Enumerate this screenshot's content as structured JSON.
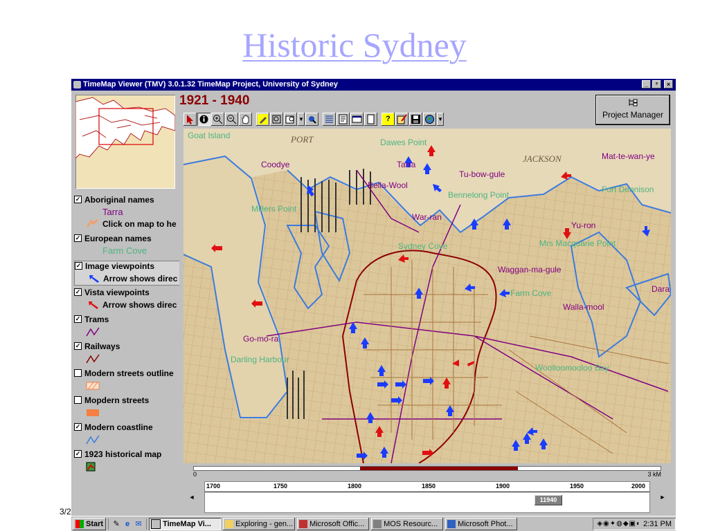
{
  "slide": {
    "title": "Historic Sydney",
    "date": "3/2"
  },
  "window": {
    "title": "TimeMap Viewer (TMV) 3.0.1.32 TimeMap Project, University of Sydney",
    "controls": [
      "_",
      "²",
      "×"
    ]
  },
  "period": "1921 - 1940",
  "project_manager": {
    "label": "Project Manager"
  },
  "toolbar": {
    "buttons": [
      "select-arrow",
      "info",
      "zoom-in",
      "zoom-out",
      "pan-hand",
      "pencil",
      "zoom-box",
      "zoom-layer",
      "dropdown",
      "locate",
      "list",
      "properties",
      "window",
      "page",
      "help",
      "edit-note",
      "save",
      "globe",
      "dropdown"
    ]
  },
  "legend": {
    "groups": [
      {
        "label": "Aboriginal names",
        "checked": true,
        "items": [
          {
            "text": "Tarra",
            "color": "#800080",
            "sym": "text"
          },
          {
            "text": "Click on map to he",
            "sym": "hand"
          }
        ]
      },
      {
        "label": "European names",
        "checked": true,
        "items": [
          {
            "text": "Farm Cove",
            "color": "#4db380",
            "sym": "text"
          }
        ]
      },
      {
        "label": "Image viewpoints",
        "checked": true,
        "items": [
          {
            "text": "Arrow shows direc",
            "sym": "arrow-blue"
          }
        ]
      },
      {
        "label": "Vista viewpoints",
        "checked": true,
        "items": [
          {
            "text": "Arrow shows direc",
            "sym": "arrow-red"
          }
        ]
      },
      {
        "label": "Trams",
        "checked": true,
        "items": [
          {
            "sym": "tram-line"
          }
        ]
      },
      {
        "label": "Railways",
        "checked": true,
        "items": [
          {
            "sym": "rail-line"
          }
        ]
      },
      {
        "label": "Modern streets outline",
        "checked": false,
        "items": [
          {
            "sym": "orange-hatch"
          }
        ]
      },
      {
        "label": "Mopdern streets",
        "checked": false,
        "items": [
          {
            "sym": "orange-fill"
          }
        ]
      },
      {
        "label": "Modern coastline",
        "checked": true,
        "items": [
          {
            "sym": "coast-line"
          }
        ]
      },
      {
        "label": "1923 historical map",
        "checked": true,
        "items": [
          {
            "sym": "map-swatch"
          }
        ]
      }
    ]
  },
  "map_labels": {
    "aboriginal": [
      "Coodye",
      "Tarra",
      "Tu-bow-gule",
      "Bella-Wool",
      "War-ran",
      "Mat-te-wan-ye",
      "Yu-ron",
      "Waggan-ma-gule",
      "Walla-mool",
      "Go-mo-ra",
      "Dara"
    ],
    "european": [
      "Goat Island",
      "Dawes Point",
      "Bennelong Point",
      "Fort Dennison",
      "Millers Point",
      "Sydney Cove",
      "Mrs Macquarie Point",
      "Farm Cove",
      "Darling Harbour",
      "Woolloomooloo Bay"
    ],
    "printed": [
      "PORT",
      "JACKSON"
    ]
  },
  "scale": {
    "start": "0",
    "end": "3 kM"
  },
  "timeline": {
    "ticks": [
      "1700",
      "1750",
      "1800",
      "1850",
      "1900",
      "1950",
      "2000"
    ],
    "thumb": "11940",
    "left_arrow": "◄",
    "right_arrow": "►"
  },
  "taskbar": {
    "start": "Start",
    "tasks": [
      "TimeMap Vi...",
      "Exploring - gen...",
      "Microsoft Offic...",
      "MOS Resourc...",
      "Microsoft Phot..."
    ],
    "clock": "2:31 PM"
  },
  "colors": {
    "aboriginal": "#800080",
    "european": "#4db380",
    "viewpoint": "#1a3cff",
    "vista": "#e01010",
    "tram": "#800080",
    "railway": "#8b0000",
    "coastline": "#3b7be0",
    "titlebar": "#000080"
  }
}
